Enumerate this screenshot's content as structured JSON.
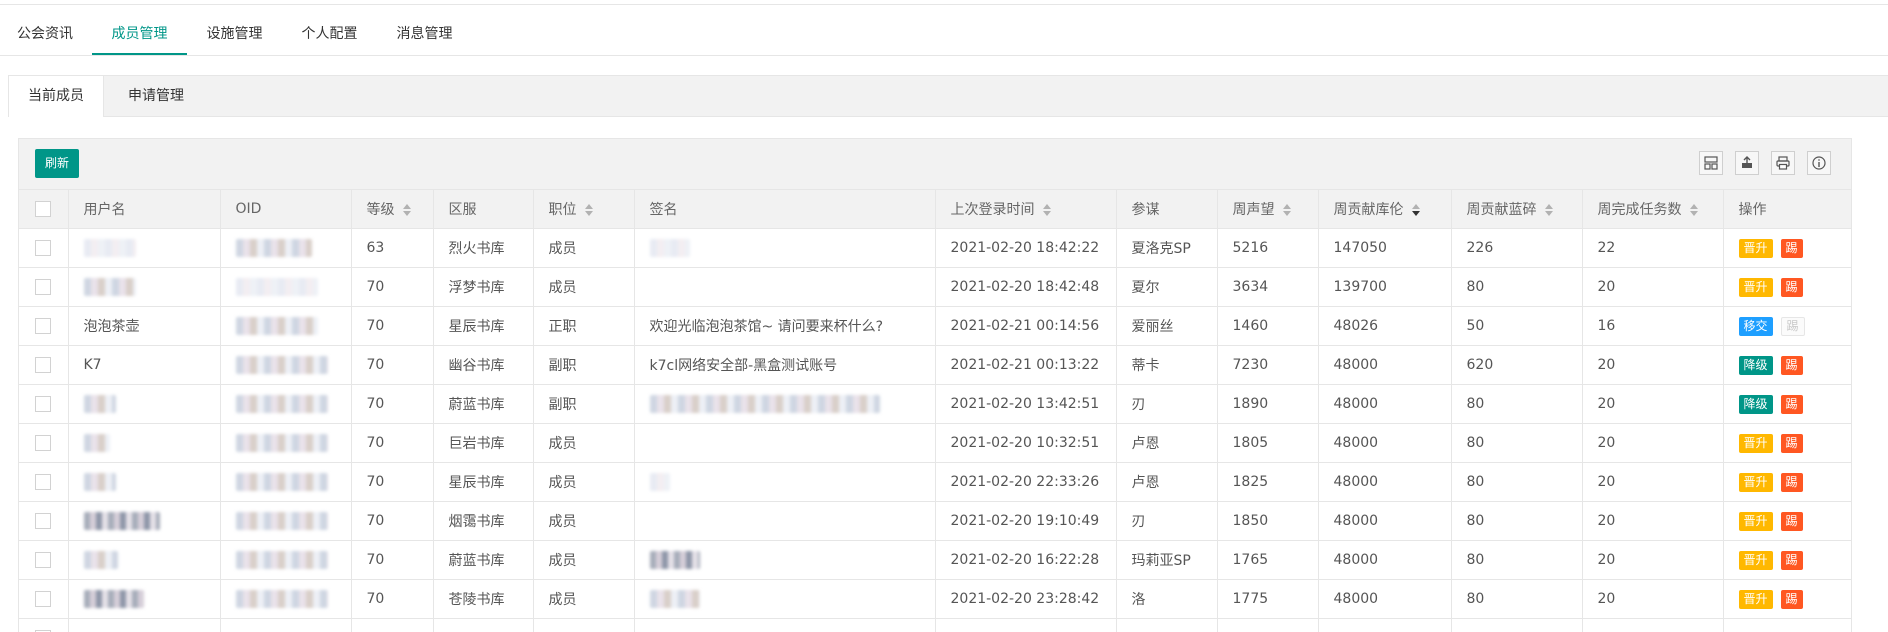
{
  "top_tabs": [
    {
      "label": "公会资讯",
      "active": false
    },
    {
      "label": "成员管理",
      "active": true
    },
    {
      "label": "设施管理",
      "active": false
    },
    {
      "label": "个人配置",
      "active": false
    },
    {
      "label": "消息管理",
      "active": false
    }
  ],
  "sub_tabs": [
    {
      "label": "当前成员",
      "active": true
    },
    {
      "label": "申请管理",
      "active": false
    }
  ],
  "toolbar": {
    "refresh_label": "刷新",
    "icons": [
      "columns-icon",
      "export-icon",
      "print-icon",
      "info-icon"
    ]
  },
  "table": {
    "columns": [
      "用户名",
      "OID",
      "等级",
      "区服",
      "职位",
      "签名",
      "上次登录时间",
      "参谋",
      "周声望",
      "周贡献库伦",
      "周贡献蓝碎",
      "周完成任务数",
      "操作"
    ],
    "sorted_column": "周贡献库伦",
    "sort_direction": "desc",
    "rows": [
      {
        "username": "",
        "oid": "",
        "level": "63",
        "server": "烈火书库",
        "position": "成员",
        "signature": "",
        "last_login": "2021-02-20 18:42:22",
        "advisor": "夏洛克SP",
        "weekly_rep": "5216",
        "weekly_coulomb": "147050",
        "weekly_blue": "226",
        "weekly_tasks": "22",
        "actions": [
          "晋升",
          "踢"
        ]
      },
      {
        "username": "",
        "oid": "",
        "level": "70",
        "server": "浮梦书库",
        "position": "成员",
        "signature": "",
        "last_login": "2021-02-20 18:42:48",
        "advisor": "夏尔",
        "weekly_rep": "3634",
        "weekly_coulomb": "139700",
        "weekly_blue": "80",
        "weekly_tasks": "20",
        "actions": [
          "晋升",
          "踢"
        ]
      },
      {
        "username": "泡泡茶壶",
        "oid": "",
        "level": "70",
        "server": "星辰书库",
        "position": "正职",
        "signature": "欢迎光临泡泡茶馆~ 请问要来杯什么?",
        "last_login": "2021-02-21 00:14:56",
        "advisor": "爱丽丝",
        "weekly_rep": "1460",
        "weekly_coulomb": "48026",
        "weekly_blue": "50",
        "weekly_tasks": "16",
        "actions": [
          "移交",
          "踢"
        ]
      },
      {
        "username": "K7",
        "oid": "",
        "level": "70",
        "server": "幽谷书库",
        "position": "副职",
        "signature": "k7cl网络安全部-黑盒测试账号",
        "last_login": "2021-02-21 00:13:22",
        "advisor": "蒂卡",
        "weekly_rep": "7230",
        "weekly_coulomb": "48000",
        "weekly_blue": "620",
        "weekly_tasks": "20",
        "actions": [
          "降级",
          "踢"
        ]
      },
      {
        "username": "",
        "oid": "",
        "level": "70",
        "server": "蔚蓝书库",
        "position": "副职",
        "signature": "",
        "last_login": "2021-02-20 13:42:51",
        "advisor": "刃",
        "weekly_rep": "1890",
        "weekly_coulomb": "48000",
        "weekly_blue": "80",
        "weekly_tasks": "20",
        "actions": [
          "降级",
          "踢"
        ]
      },
      {
        "username": "",
        "oid": "",
        "level": "70",
        "server": "巨岩书库",
        "position": "成员",
        "signature": "",
        "last_login": "2021-02-20 10:32:51",
        "advisor": "卢恩",
        "weekly_rep": "1805",
        "weekly_coulomb": "48000",
        "weekly_blue": "80",
        "weekly_tasks": "20",
        "actions": [
          "晋升",
          "踢"
        ]
      },
      {
        "username": "",
        "oid": "",
        "level": "70",
        "server": "星辰书库",
        "position": "成员",
        "signature": "",
        "last_login": "2021-02-20 22:33:26",
        "advisor": "卢恩",
        "weekly_rep": "1825",
        "weekly_coulomb": "48000",
        "weekly_blue": "80",
        "weekly_tasks": "20",
        "actions": [
          "晋升",
          "踢"
        ]
      },
      {
        "username": "",
        "oid": "",
        "level": "70",
        "server": "烟霭书库",
        "position": "成员",
        "signature": "",
        "last_login": "2021-02-20 19:10:49",
        "advisor": "刃",
        "weekly_rep": "1850",
        "weekly_coulomb": "48000",
        "weekly_blue": "80",
        "weekly_tasks": "20",
        "actions": [
          "晋升",
          "踢"
        ]
      },
      {
        "username": "",
        "oid": "",
        "level": "70",
        "server": "蔚蓝书库",
        "position": "成员",
        "signature": "",
        "last_login": "2021-02-20 16:22:28",
        "advisor": "玛莉亚SP",
        "weekly_rep": "1765",
        "weekly_coulomb": "48000",
        "weekly_blue": "80",
        "weekly_tasks": "20",
        "actions": [
          "晋升",
          "踢"
        ]
      },
      {
        "username": "",
        "oid": "",
        "level": "70",
        "server": "苍陵书库",
        "position": "成员",
        "signature": "",
        "last_login": "2021-02-20 23:28:42",
        "advisor": "洛",
        "weekly_rep": "1775",
        "weekly_coulomb": "48000",
        "weekly_blue": "80",
        "weekly_tasks": "20",
        "actions": [
          "晋升",
          "踢"
        ]
      }
    ]
  },
  "colors": {
    "accent": "#009688",
    "promote": "#ffb800",
    "demote": "#009688",
    "transfer": "#1e9fff",
    "kick": "#ff5722"
  }
}
